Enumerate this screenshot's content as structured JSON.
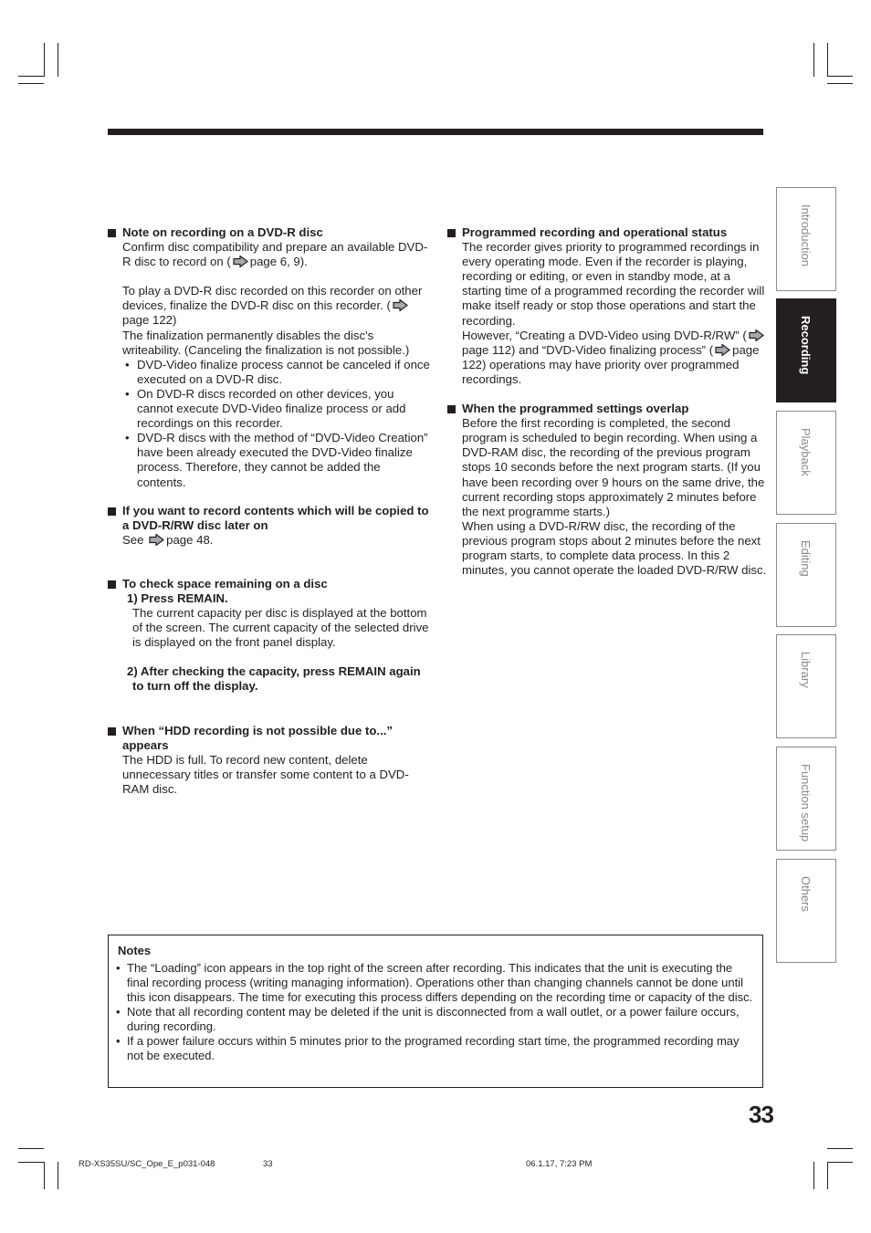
{
  "page": {
    "number": "33"
  },
  "left_column": {
    "sections": [
      {
        "heading": "Note on recording on a DVD-R disc",
        "para1_a": "Confirm disc compatibility and prepare an available DVD-R disc to record on (",
        "para1_ref": "page 6, 9).",
        "para2_a": "To play a DVD-R disc recorded on this recorder on other devices, finalize the DVD-R disc on this recorder. (",
        "para2_ref": "page 122)",
        "para3": "The finalization permanently disables the disc's writeability. (Canceling the finalization is not possible.)",
        "bullets": [
          "DVD-Video finalize process cannot be canceled if once executed on a DVD-R disc.",
          "On DVD-R discs recorded on other devices, you cannot execute DVD-Video finalize process or add recordings on this recorder.",
          "DVD-R discs with the method of “DVD-Video Creation” have been already executed the DVD-Video finalize process. Therefore, they cannot be added the contents."
        ]
      },
      {
        "heading": "If you want to record contents which will be copied to a DVD-R/RW disc later on",
        "see_label": "See",
        "see_ref": "page 48."
      },
      {
        "heading": "To check space remaining on a disc",
        "steps": [
          {
            "label": "1) Press REMAIN.",
            "body": "The current capacity per disc is displayed at the bottom of the screen. The current capacity of the selected drive is displayed on the front panel display."
          },
          {
            "label": "2) After checking the capacity, press REMAIN again to turn off the display.",
            "body": ""
          }
        ]
      },
      {
        "heading": "When “HDD recording is not possible due to...” appears",
        "body": "The HDD is full. To record new content, delete unnecessary titles or transfer some content to a DVD-RAM disc."
      }
    ]
  },
  "right_column": {
    "sections": [
      {
        "heading": "Programmed recording and operational status",
        "body1": "The recorder gives priority to programmed recordings in every operating mode. Even if the recorder is playing, recording or editing, or even in standby mode, at a starting time of a programmed recording the recorder will make itself ready or stop those operations and start the recording.",
        "body2_a": "However, “Creating a DVD-Video using DVD-R/RW” (",
        "body2_ref1": "page 112) and “DVD-Video finalizing process” (",
        "body2_ref2": "page 122) operations may have priority over programmed recordings."
      },
      {
        "heading": "When the programmed settings overlap",
        "body1": "Before the first recording is completed, the second program is scheduled to begin recording. When using a DVD-RAM disc, the recording of the previous program stops 10 seconds before the next program starts. (If you have been recording over 9 hours on the same drive, the current recording stops approximately 2 minutes before the next programme starts.)",
        "body2": "When using a DVD-R/RW disc, the recording of the previous program stops about 2 minutes before the next program starts, to complete data process. In this 2 minutes, you cannot operate the loaded DVD-R/RW disc."
      }
    ]
  },
  "side_tabs": [
    {
      "label": "Introduction",
      "active": false
    },
    {
      "label": "Recording",
      "active": true
    },
    {
      "label": "Playback",
      "active": false
    },
    {
      "label": "Editing",
      "active": false
    },
    {
      "label": "Library",
      "active": false
    },
    {
      "label": "Function setup",
      "active": false
    },
    {
      "label": "Others",
      "active": false
    }
  ],
  "notes": {
    "title": "Notes",
    "items": [
      "The “Loading” icon appears in the top right of the screen after recording. This indicates that the unit is executing the final recording process (writing managing information). Operations other than changing channels cannot be done until this icon disappears. The time for executing this process differs depending on the recording time or capacity of the disc.",
      "Note that all recording content may be deleted if the unit is disconnected from a wall outlet, or a power failure occurs, during recording.",
      "If a power failure occurs within 5 minutes prior to the programed recording start time, the programmed recording may not be executed."
    ]
  },
  "footer": {
    "file": "RD-XS35SU/SC_Ope_E_p031-048",
    "page": "33",
    "timestamp": "06.1.17, 7:23 PM"
  },
  "icons": {
    "bullet": "•",
    "reference_arrow": "arrow-right-icon",
    "section_marker": "black-square-icon"
  },
  "colors": {
    "text": "#231f20",
    "tab_inactive_text": "#8a8a8a",
    "tab_active_bg": "#231f20",
    "reference_arrow_fill": "#a7a9ac"
  }
}
